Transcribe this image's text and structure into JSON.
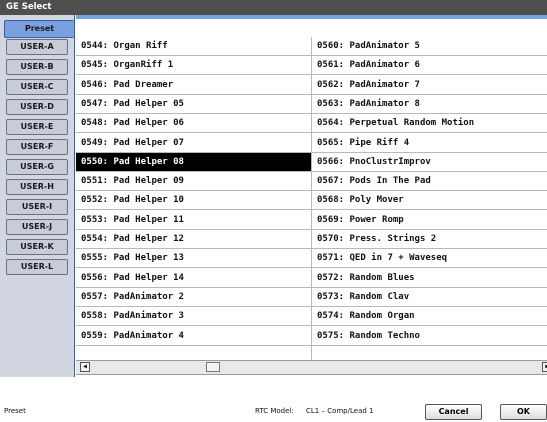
{
  "window": {
    "title": "GE Select"
  },
  "tabs": [
    "Preset",
    "USER-A",
    "USER-B",
    "USER-C",
    "USER-D",
    "USER-E",
    "USER-F",
    "USER-G",
    "USER-H",
    "USER-I",
    "USER-J",
    "USER-K",
    "USER-L"
  ],
  "active_tab": "Preset",
  "list": {
    "left": [
      "0544: Organ Riff",
      "0545: OrganRiff 1",
      "0546: Pad Dreamer",
      "0547: Pad Helper 05",
      "0548: Pad Helper 06",
      "0549: Pad Helper 07",
      "0550: Pad Helper 08",
      "0551: Pad Helper 09",
      "0552: Pad Helper 10",
      "0553: Pad Helper 11",
      "0554: Pad Helper 12",
      "0555: Pad Helper 13",
      "0556: Pad Helper 14",
      "0557: PadAnimator 2",
      "0558: PadAnimator 3",
      "0559: PadAnimator 4"
    ],
    "right": [
      "0560: PadAnimator 5",
      "0561: PadAnimator 6",
      "0562: PadAnimator 7",
      "0563: PadAnimator 8",
      "0564: Perpetual Random Motion",
      "0565: Pipe Riff 4",
      "0566: PnoClustrImprov",
      "0567: Pods In The Pad",
      "0568: Poly Mover",
      "0569: Power Romp",
      "0570: Press. Strings 2",
      "0571: QED in 7 + Waveseq",
      "0572: Random Blues",
      "0573: Random Clav",
      "0574: Random Organ",
      "0575: Random Techno"
    ],
    "selected": "0550: Pad Helper 08"
  },
  "scrollbar": {
    "left_arrow_icon": "arrow-left-icon",
    "right_arrow_icon": "arrow-right-icon"
  },
  "status": {
    "category": "Preset",
    "rtc_label": "RTC Model:",
    "rtc_value": "CL1 – Comp/Lead 1",
    "cancel_label": "Cancel",
    "ok_label": "OK"
  },
  "colors": {
    "title_bar": "#4f4f4f",
    "tab_active": "#7aa0e0",
    "selection": "#000000",
    "sidebar": "#d2d6e0"
  }
}
